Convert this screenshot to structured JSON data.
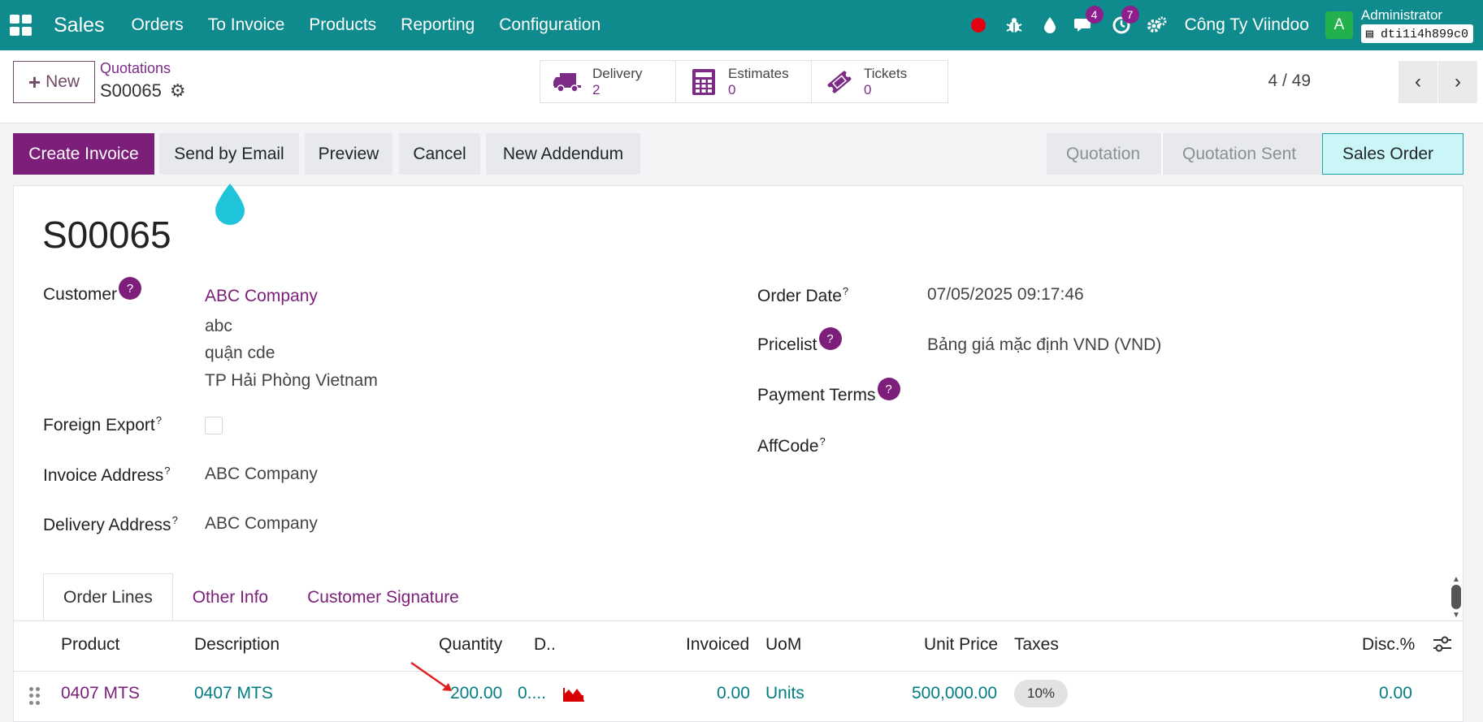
{
  "navbar": {
    "brand": "Sales",
    "menu": [
      "Orders",
      "To Invoice",
      "Products",
      "Reporting",
      "Configuration"
    ],
    "messages_count": "4",
    "activities_count": "7",
    "company": "Công Ty Viindoo",
    "avatar_letter": "A",
    "user": "Administrator",
    "database": "dti1i4h899c0"
  },
  "control": {
    "new_label": "New",
    "breadcrumb_parent": "Quotations",
    "breadcrumb_current": "S00065",
    "smart_buttons": [
      {
        "label": "Delivery",
        "value": "2",
        "icon": "truck-icon"
      },
      {
        "label": "Estimates",
        "value": "0",
        "icon": "calculator-icon"
      },
      {
        "label": "Tickets",
        "value": "0",
        "icon": "ticket-icon"
      }
    ],
    "pager": "4 / 49"
  },
  "actions": {
    "create_invoice": "Create Invoice",
    "send_email": "Send by Email",
    "preview": "Preview",
    "cancel": "Cancel",
    "new_addendum": "New Addendum",
    "stages": [
      "Quotation",
      "Quotation Sent",
      "Sales Order"
    ],
    "active_stage": "Sales Order"
  },
  "form": {
    "title": "S00065",
    "customer_label": "Customer",
    "customer_name": "ABC Company",
    "customer_addr1": "abc",
    "customer_addr2": "quận cde",
    "customer_addr3": "TP Hải Phòng Vietnam",
    "foreign_export_label": "Foreign Export",
    "invoice_address_label": "Invoice Address",
    "invoice_address": "ABC Company",
    "delivery_address_label": "Delivery Address",
    "delivery_address": "ABC Company",
    "order_date_label": "Order Date",
    "order_date": "07/05/2025 09:17:46",
    "pricelist_label": "Pricelist",
    "pricelist": "Bảng giá mặc định VND (VND)",
    "payment_terms_label": "Payment Terms",
    "affcode_label": "AffCode",
    "help_mark": "?"
  },
  "tabs": [
    "Order Lines",
    "Other Info",
    "Customer Signature"
  ],
  "table": {
    "headers": {
      "product": "Product",
      "description": "Description",
      "quantity": "Quantity",
      "delivered": "D..",
      "invoiced": "Invoiced",
      "uom": "UoM",
      "unit_price": "Unit Price",
      "taxes": "Taxes",
      "discount": "Disc.%"
    },
    "row": {
      "product": "0407 MTS",
      "description": "0407 MTS",
      "quantity": "200.00",
      "delivered": "0....",
      "invoiced": "0.00",
      "uom": "Units",
      "unit_price": "500,000.00",
      "taxes": "10%",
      "discount": "0.00"
    }
  }
}
